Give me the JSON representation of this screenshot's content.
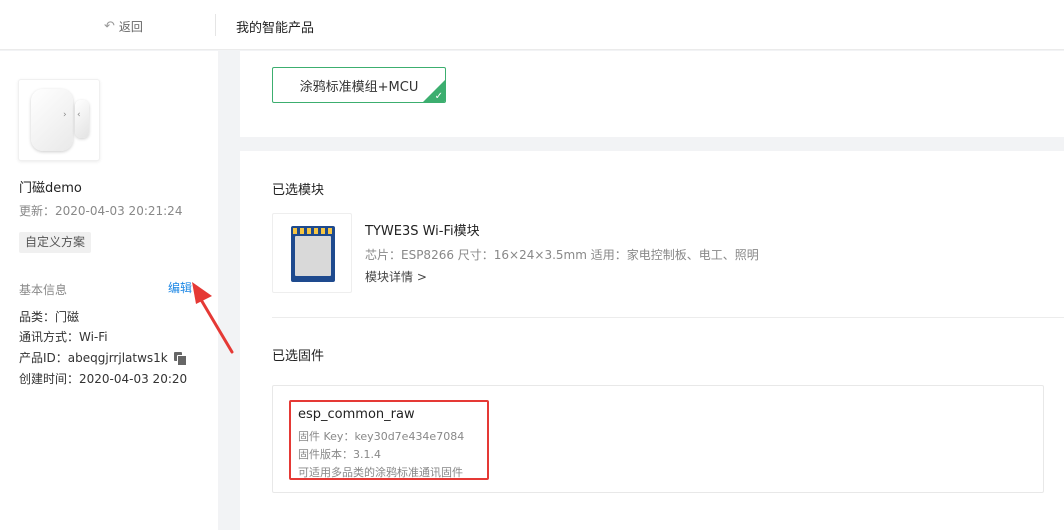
{
  "header": {
    "back_label": "返回",
    "title": "我的智能产品"
  },
  "sidebar": {
    "product_name": "门磁demo",
    "updated": "更新：2020-04-03 20:21:24",
    "tag": "自定义方案",
    "basic_info_label": "基本信息",
    "edit_label": "编辑",
    "category": "品类：门磁",
    "protocol": "通讯方式：Wi-Fi",
    "product_id": "产品ID：abeqgjrrjlatws1k",
    "created": "创建时间：2020-04-03 20:20"
  },
  "main": {
    "scheme_option": "涂鸦标准模组+MCU",
    "selected_module_title": "已选模块",
    "module": {
      "name": "TYWE3S Wi-Fi模块",
      "spec": "芯片：ESP8266    尺寸：16×24×3.5mm    适用：家电控制板、电工、照明",
      "detail_link": "模块详情 >"
    },
    "selected_firmware_title": "已选固件",
    "firmware": {
      "name": "esp_common_raw",
      "key": "固件 Key：key30d7e434e7084",
      "version": "固件版本：3.1.4",
      "desc": "可适用多品类的涂鸦标准通讯固件"
    }
  },
  "colors": {
    "accent_green": "#3cae6f",
    "link_blue": "#1e88e5",
    "highlight_red": "#e53935"
  }
}
